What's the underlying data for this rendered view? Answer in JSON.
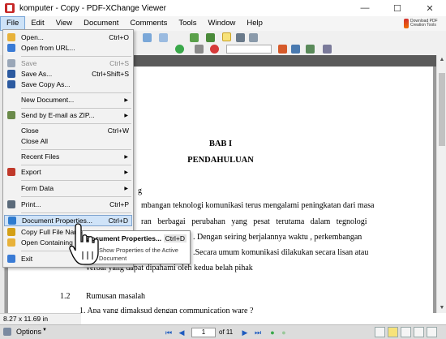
{
  "window": {
    "title": "komputer - Copy - PDF-XChange Viewer",
    "minimize": "—",
    "maximize": "☐",
    "close": "✕"
  },
  "menubar": [
    "File",
    "Edit",
    "View",
    "Document",
    "Comments",
    "Tools",
    "Window",
    "Help"
  ],
  "brand": {
    "text": "Download PDF Creation Tools"
  },
  "file_menu": [
    {
      "label": "Open...",
      "shortcut": "Ctrl+O",
      "icon": "folder-open-icon",
      "color": "#e8b23a"
    },
    {
      "label": "Open from URL...",
      "shortcut": "",
      "icon": "web-open-icon",
      "color": "#3a7bd5"
    },
    {
      "label": "Save",
      "shortcut": "Ctrl+S",
      "icon": "save-icon",
      "disabled": true,
      "color": "#9aa7b8"
    },
    {
      "label": "Save As...",
      "shortcut": "Ctrl+Shift+S",
      "icon": "save-as-icon",
      "color": "#2c5aa0"
    },
    {
      "label": "Save Copy As...",
      "shortcut": "",
      "icon": "save-copy-icon",
      "color": "#2c5aa0"
    },
    {
      "label": "New Document...",
      "submenu": true
    },
    {
      "label": "Send by E-mail as ZIP...",
      "icon": "email-zip-icon",
      "submenu": true,
      "color": "#6a8a4a"
    },
    {
      "label": "Close",
      "shortcut": "Ctrl+W"
    },
    {
      "label": "Close All",
      "shortcut": ""
    },
    {
      "label": "Recent Files",
      "submenu": true
    },
    {
      "label": "Export",
      "icon": "export-icon",
      "submenu": true,
      "color": "#c0392b"
    },
    {
      "label": "Form Data",
      "submenu": true
    },
    {
      "label": "Print...",
      "shortcut": "Ctrl+P",
      "icon": "print-icon",
      "color": "#5a6a7a"
    },
    {
      "label": "Document Properties...",
      "shortcut": "Ctrl+D",
      "icon": "document-properties-icon",
      "highlighted": true,
      "color": "#2e7bcf"
    },
    {
      "label": "Copy Full File Name",
      "icon": "copy-filename-icon",
      "color": "#d4a017"
    },
    {
      "label": "Open Containing Folder",
      "icon": "open-folder-icon",
      "color": "#e8b23a"
    },
    {
      "label": "Exit",
      "icon": "exit-icon",
      "color": "#3a7bd5"
    }
  ],
  "tooltip": {
    "title": "Document Properties...",
    "shortcut": "Ctrl+D",
    "description": "Show Properties of the Active Document"
  },
  "document": {
    "chapter": "BAB I",
    "chapter_title": "PENDAHULUAN",
    "left_fragments": [
      "g",
      "mbangan teknologi komunikasi terus mengalami peningkatan dari masa",
      "ran   berbagai   perubahan   yang   pesat   terutama   dalam   tegnologi",
      ". Dengan seiring berjalannya waktu , perkembangan",
      ".Secara umum komunikasi dilakukan secara lisan atau",
      "verbal yang dapat dipahami oleh kedua belah pihak"
    ],
    "section_number": "1.2",
    "section_title": "Rumusan masalah",
    "question": "1. Apa yang dimaksud dengan communication ware ?"
  },
  "page_size": "8.27 x 11.69 in",
  "status": {
    "options_label": "Options",
    "current_page": "1",
    "page_total": "of 11"
  }
}
